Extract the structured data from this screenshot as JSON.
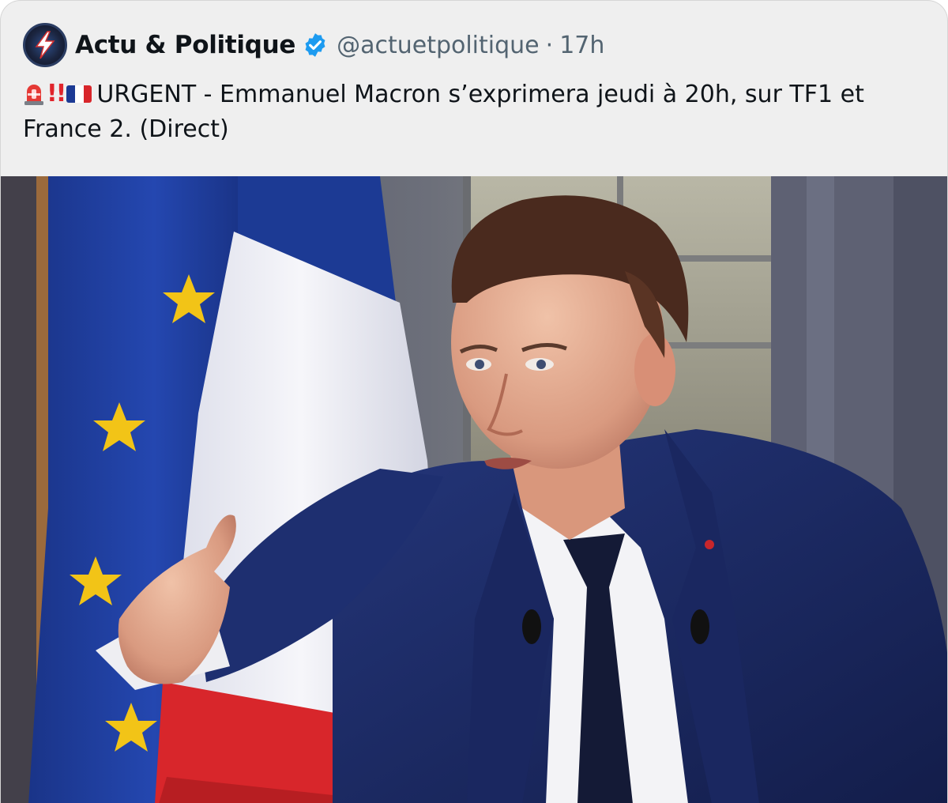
{
  "tweet": {
    "author_name": "Actu & Politique",
    "handle": "@actuetpolitique",
    "separator": "·",
    "time": "17h",
    "emoji_prefix": [
      "rotating-light-emoji",
      "double-exclamation-emoji",
      "france-flag-emoji"
    ],
    "text": "URGENT - Emmanuel Macron s’exprimera jeudi à 20h, sur TF1 et France 2. (Direct)"
  },
  "colors": {
    "verified": "#1d9bf0",
    "eu_blue": "#1f3f9e",
    "eu_star": "#f2c417",
    "fr_blue": "#1c3a94",
    "fr_red": "#d8262b"
  }
}
